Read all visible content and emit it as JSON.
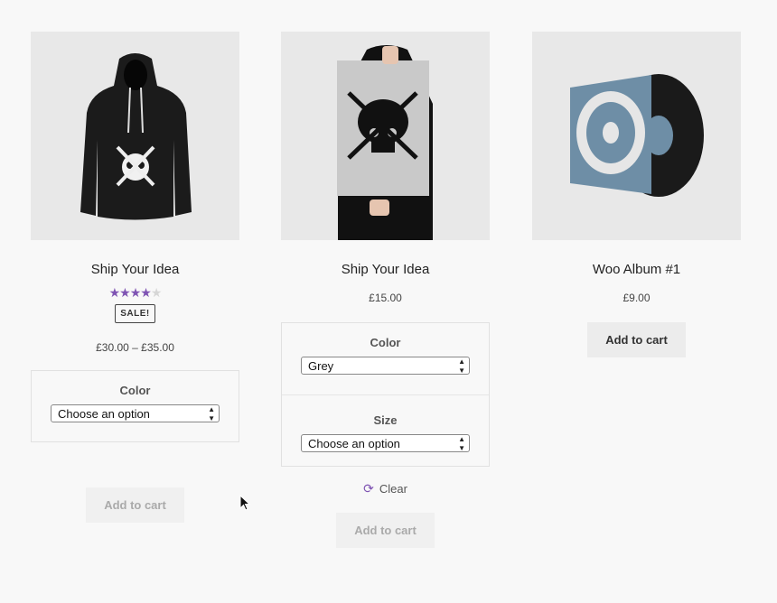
{
  "colors": {
    "accent": "#7f54b3",
    "background": "#f8f8f8"
  },
  "products": [
    {
      "title": "Ship Your Idea",
      "rating_stars": 4,
      "rating_max": 5,
      "sale_badge": "SALE!",
      "price": "£30.00 – £35.00",
      "variations": [
        {
          "label": "Color",
          "value": "Choose an option"
        }
      ],
      "button": "Add to cart",
      "image_icon": "hoodie-image"
    },
    {
      "title": "Ship Your Idea",
      "price": "£15.00",
      "variations": [
        {
          "label": "Color",
          "value": "Grey"
        },
        {
          "label": "Size",
          "value": "Choose an option"
        }
      ],
      "clear_label": "Clear",
      "button": "Add to cart",
      "image_icon": "poster-image"
    },
    {
      "title": "Woo Album #1",
      "price": "£9.00",
      "button": "Add to cart",
      "image_icon": "album-image"
    }
  ]
}
